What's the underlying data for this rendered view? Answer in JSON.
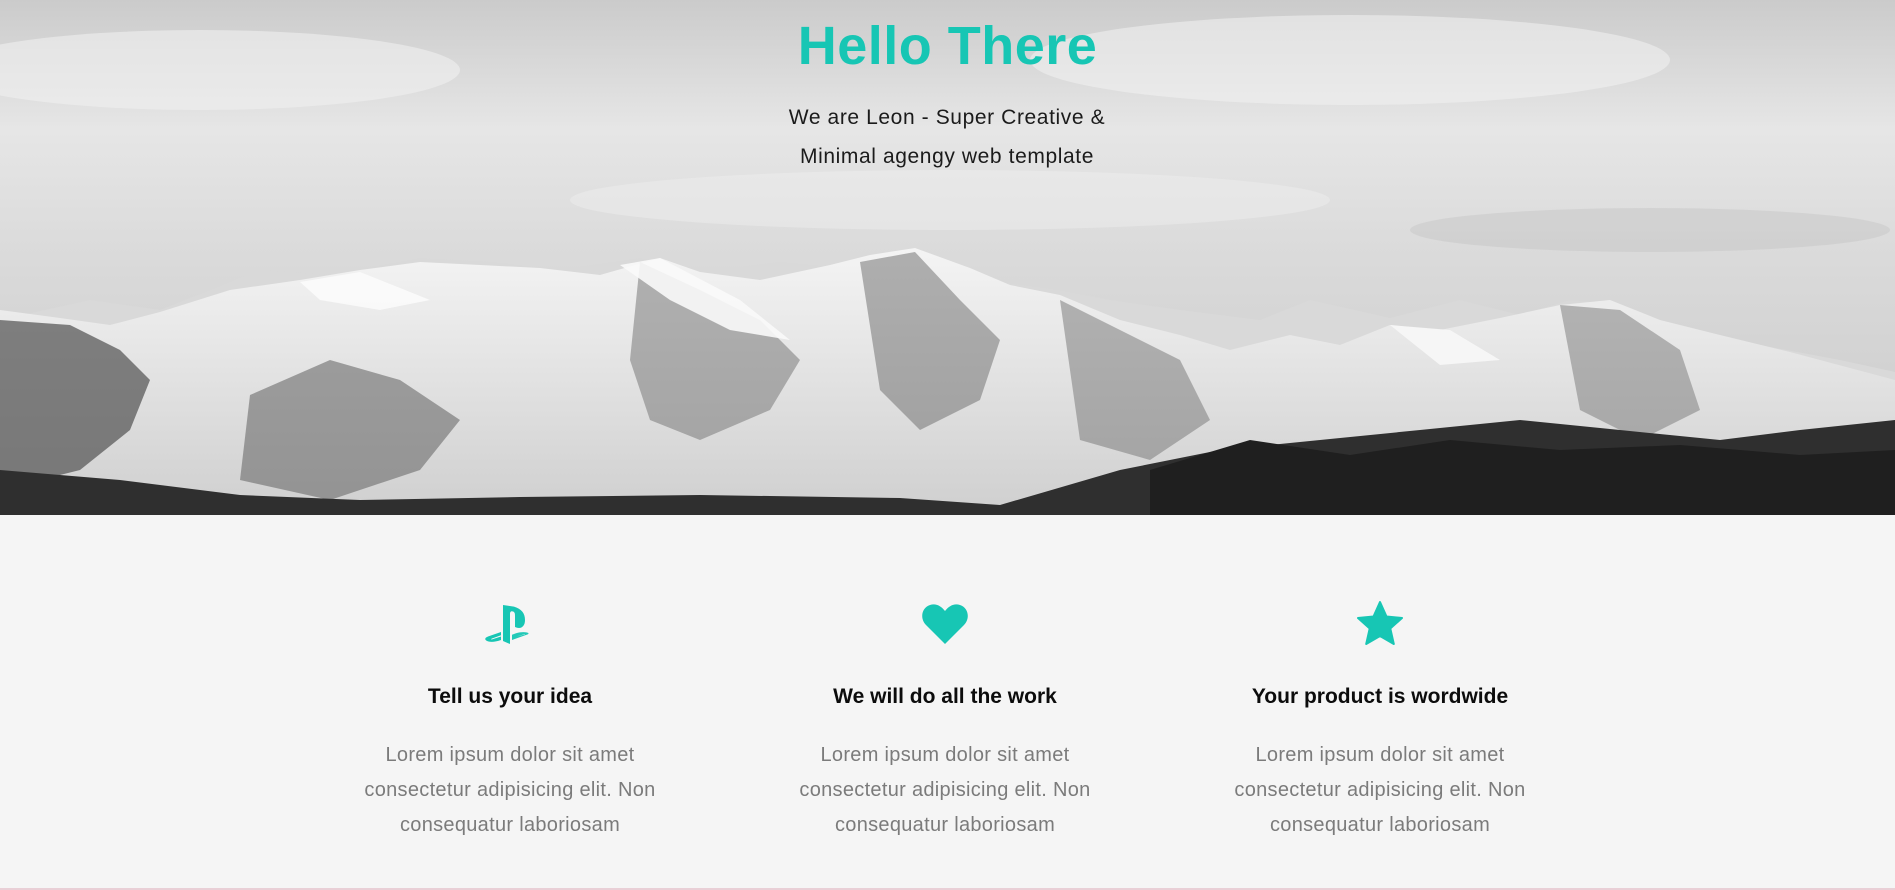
{
  "hero": {
    "title": "Hello There",
    "subtitle_line1": "We are Leon - Super Creative &",
    "subtitle_line2": "Minimal agengy web template",
    "background": "mountain-photo-grayscale"
  },
  "features": {
    "items": [
      {
        "icon": "playstation-icon",
        "title": "Tell us your idea",
        "text": "Lorem ipsum dolor sit amet consectetur adipisicing elit. Non consequatur laboriosam"
      },
      {
        "icon": "heart-icon",
        "title": "We will do all the work",
        "text": "Lorem ipsum dolor sit amet consectetur adipisicing elit. Non consequatur laboriosam"
      },
      {
        "icon": "star-icon",
        "title": "Your product is wordwide",
        "text": "Lorem ipsum dolor sit amet consectetur adipisicing elit. Non consequatur laboriosam"
      }
    ]
  },
  "colors": {
    "accent": "#17c6b4",
    "heading": "#0c0c0c",
    "body_text": "#7b7b7b",
    "section_background": "#f5f5f5"
  }
}
